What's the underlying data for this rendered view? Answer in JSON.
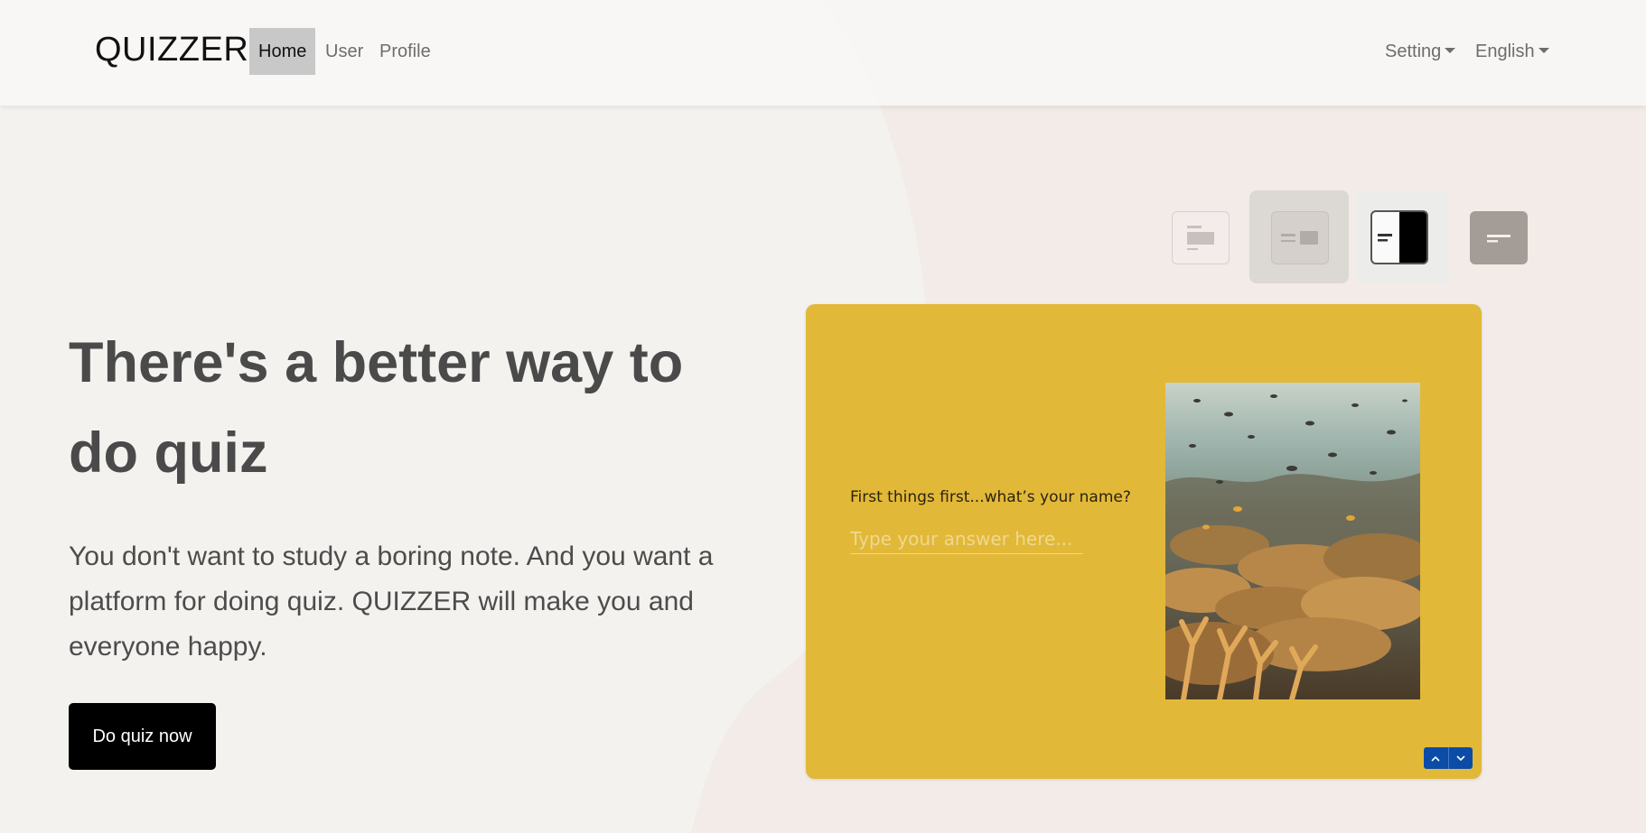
{
  "navbar": {
    "brand": "QUIZZER",
    "links": [
      {
        "label": "Home",
        "active": true
      },
      {
        "label": "User"
      },
      {
        "label": "Profile"
      }
    ],
    "setting_label": "Setting",
    "language_label": "English"
  },
  "hero": {
    "title": "There's a better way to do quiz",
    "description": "You don't want to study a boring note. And you want a platform for doing quiz. QUIZZER will make you and everyone happy.",
    "cta_label": "Do quiz now"
  },
  "quiz_preview": {
    "question": "First things first...what’s your name?",
    "input_placeholder": "Type your answer here...",
    "image_icon": "coral-reef-image",
    "nav_up_icon": "chevron-up-icon",
    "nav_down_icon": "chevron-down-icon",
    "background_color": "#e2b838",
    "nav_color": "#0b4ca8"
  },
  "layout_options": [
    {
      "icon": "layout-text-top-image-icon"
    },
    {
      "icon": "layout-text-left-image-right-icon",
      "selected": true
    },
    {
      "icon": "layout-split-icon"
    },
    {
      "icon": "layout-text-only-icon"
    }
  ],
  "colors": {
    "accent": "#000000",
    "page_background": "#f4f2ef",
    "nav_active": "#c8c8c8"
  }
}
